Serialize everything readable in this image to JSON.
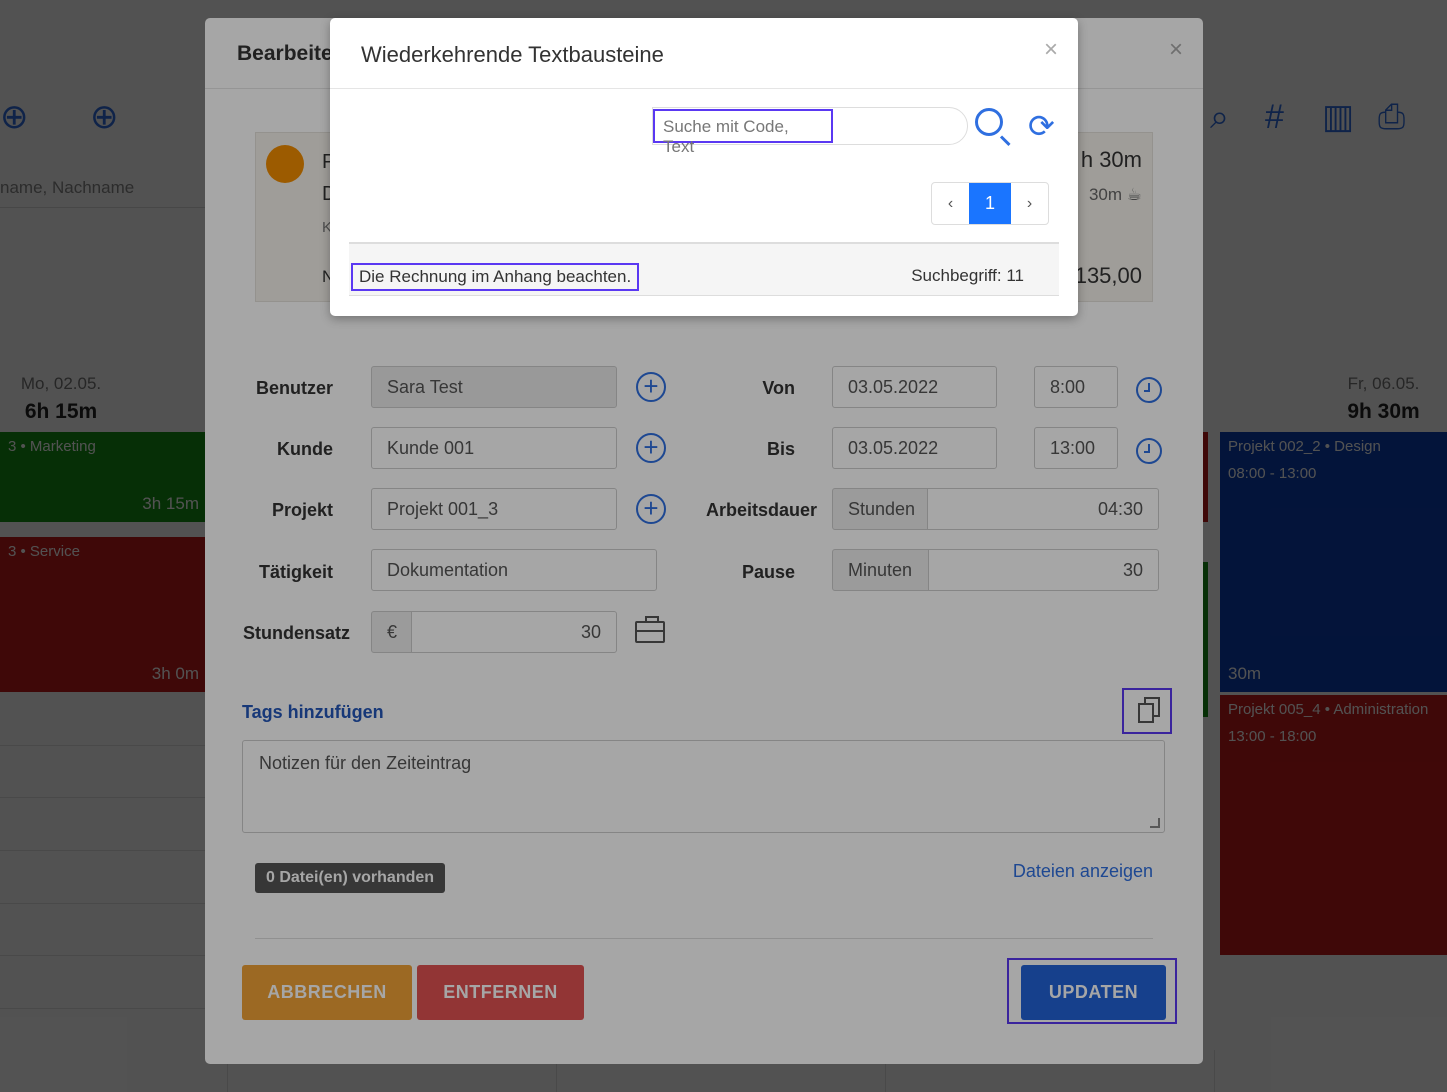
{
  "background": {
    "search_placeholder": "name, Nachname",
    "days": [
      {
        "date": "Mo, 02.05.",
        "hours": "6h 15m"
      },
      {
        "date": "Fr, 06.05.",
        "hours": "9h 30m"
      }
    ],
    "events": [
      {
        "title": "3 • Marketing",
        "duration": "3h 15m",
        "color": "#149214"
      },
      {
        "title": "3 • Service",
        "duration": "3h 0m",
        "color": "#c41a1a"
      },
      {
        "title": "Projekt 002_2 • Design",
        "time": "08:00 - 13:00",
        "pause": "30m",
        "color": "#0b3fb3"
      },
      {
        "title": "Projekt 005_4 • Administration",
        "time": "13:00 - 18:00",
        "color": "#c41a1a"
      }
    ]
  },
  "edit_modal": {
    "title": "Bearbeite",
    "summary": {
      "duration": "h 30m",
      "pause": "30m",
      "price": "135,00",
      "letters": [
        "P",
        "D",
        "K",
        "N"
      ]
    },
    "labels": {
      "user": "Benutzer",
      "customer": "Kunde",
      "project": "Projekt",
      "activity": "Tätigkeit",
      "rate": "Stundensatz",
      "from": "Von",
      "to": "Bis",
      "work_duration": "Arbeitsdauer",
      "pause": "Pause"
    },
    "values": {
      "user": "Sara Test",
      "customer": "Kunde 001",
      "project": "Projekt 001_3",
      "activity": "Dokumentation",
      "rate_currency": "€",
      "rate": "30",
      "from_date": "03.05.2022",
      "from_time": "8:00",
      "to_date": "03.05.2022",
      "to_time": "13:00",
      "work_unit": "Stunden",
      "work_value": "04:30",
      "pause_unit": "Minuten",
      "pause_value": "30"
    },
    "tags_link": "Tags hinzufügen",
    "notes_placeholder": "Notizen für den Zeiteintrag",
    "files_badge": "0 Datei(en) vorhanden",
    "files_link": "Dateien anzeigen",
    "buttons": {
      "cancel": "ABBRECHEN",
      "remove": "ENTFERNEN",
      "update": "UPDATEN"
    }
  },
  "dialog": {
    "title": "Wiederkehrende Textbausteine",
    "close": "×",
    "search_placeholder": "Suche mit Code, Text",
    "pager": {
      "prev": "‹",
      "current": "1",
      "next": "›"
    },
    "results": [
      {
        "text": "Die Rechnung im Anhang beachten.",
        "code": "Suchbegriff: 11"
      }
    ]
  }
}
